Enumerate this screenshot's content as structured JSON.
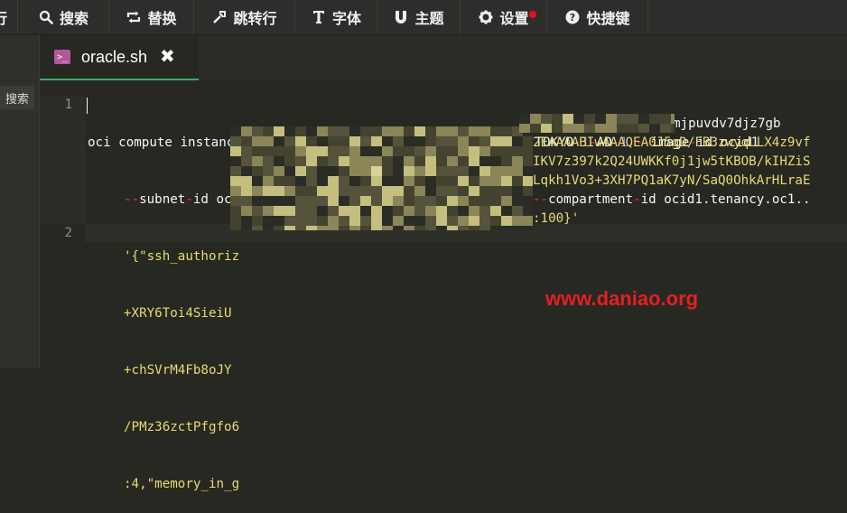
{
  "toolbar": {
    "items": [
      {
        "label": "行",
        "icon": "edge-partial"
      },
      {
        "label": "搜索",
        "icon": "search-icon"
      },
      {
        "label": "替换",
        "icon": "replace-icon"
      },
      {
        "label": "跳转行",
        "icon": "jump-icon"
      },
      {
        "label": "字体",
        "icon": "font-icon"
      },
      {
        "label": "主题",
        "icon": "theme-icon"
      },
      {
        "label": "设置",
        "icon": "gear-icon"
      },
      {
        "label": "快捷键",
        "icon": "help-icon"
      }
    ]
  },
  "sidebar": {
    "search_label": "搜索"
  },
  "tab": {
    "filename": "oracle.sh",
    "close": "✖",
    "icon": "terminal-file-icon"
  },
  "editor": {
    "line_numbers": [
      "1",
      "2"
    ],
    "lines": [
      "oci compute instance launch --availability-domain yxrF:AP-TOKYO-1-AD-1 --image-id ocid1",
      "--subnet-id ocid1.subnet.oc1.ap-tokyo-1.aaaaaa",
      "'{\"ssh_authoriz",
      "+XRY6Toi4SieiU",
      "+chSVrM4Fb8oJY",
      "/PMz36zctPfgfo6",
      ":4,\"memory_in_g"
    ],
    "right_fragments": [
      "mjpuvdv7djz7gb",
      "2EAAAABIwAAAQEA0J5gD/FB3zwyqLLX4z9vf",
      "IKV7z397k2Q24UWKKf0j1jw5tKBOB/kIHZiS",
      "Lqkh1Vo3+3XH7PQ1aK7yN/SaQ0OhkArHLraE",
      "--compartment-id ocid1.tenancy.oc1..",
      ":100}'"
    ]
  },
  "watermark": "www.daniao.org",
  "colors": {
    "background": "#272822",
    "accent_tab": "#3ea86a",
    "watermark": "#e51f25",
    "notify_dot": "#e8101c"
  }
}
